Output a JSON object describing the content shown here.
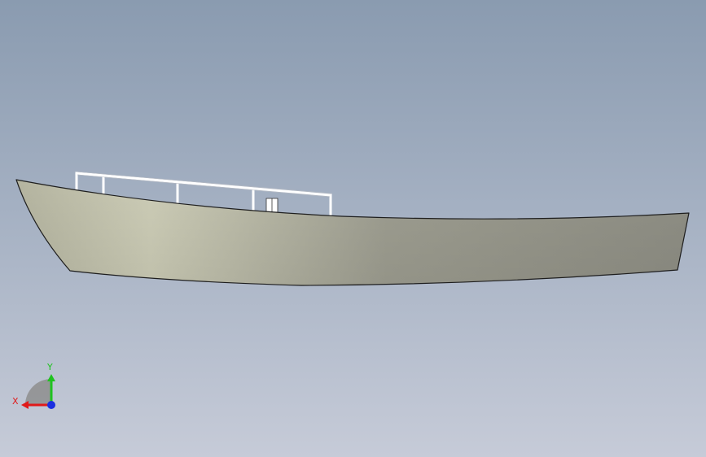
{
  "viewport": {
    "background_top": "#8a9bb0",
    "background_bottom": "#c6cbd8"
  },
  "model": {
    "hull_light": "#ccccb6",
    "hull_dark": "#8f8f85",
    "hull_outline": "#1e1e1e",
    "railing_color": "#ffffff"
  },
  "triad": {
    "x_label": "X",
    "y_label": "Y",
    "x_color": "#e01a1a",
    "y_color": "#1fc21f",
    "z_color": "#1a2fe0"
  }
}
